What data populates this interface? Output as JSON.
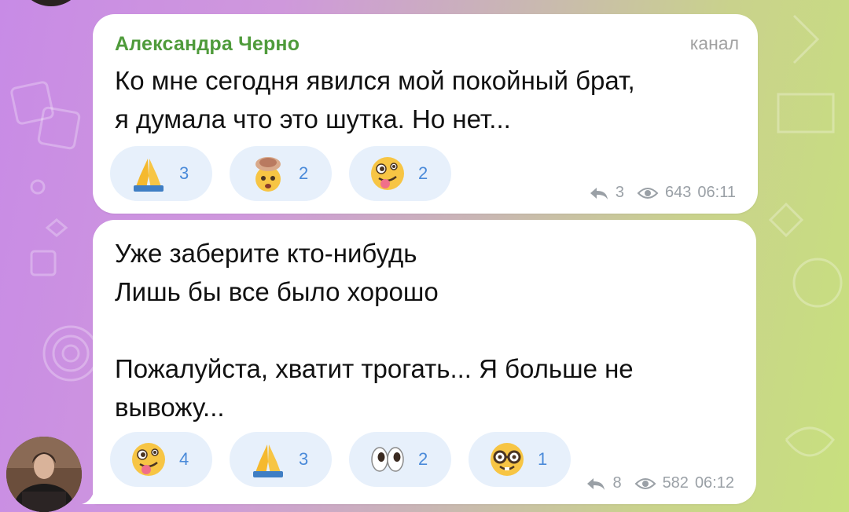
{
  "messages": [
    {
      "author": "Александра Черно",
      "channel_tag": "канал",
      "lines": [
        "Ко мне сегодня явился мой покойный брат,",
        "я думала что это шутка. Но нет..."
      ],
      "reactions": [
        {
          "emoji": "folded-hands",
          "count": "3"
        },
        {
          "emoji": "exploding-head",
          "count": "2"
        },
        {
          "emoji": "zany-face",
          "count": "2"
        }
      ],
      "replies": "3",
      "views": "643",
      "time": "06:11"
    },
    {
      "lines": [
        "Уже заберите кто-нибудь",
        "Лишь бы все было хорошо",
        "",
        "Пожалуйста, хватит трогать... Я больше не",
        "вывожу..."
      ],
      "reactions": [
        {
          "emoji": "zany-face",
          "count": "4"
        },
        {
          "emoji": "folded-hands",
          "count": "3"
        },
        {
          "emoji": "eyes",
          "count": "2"
        },
        {
          "emoji": "nerd-face",
          "count": "1"
        }
      ],
      "replies": "8",
      "views": "582",
      "time": "06:12"
    }
  ],
  "colors": {
    "author": "#4f9b3b",
    "reaction_bg": "#e7f0fb",
    "reaction_count": "#4a8ad9",
    "meta": "#9aa0a6"
  }
}
